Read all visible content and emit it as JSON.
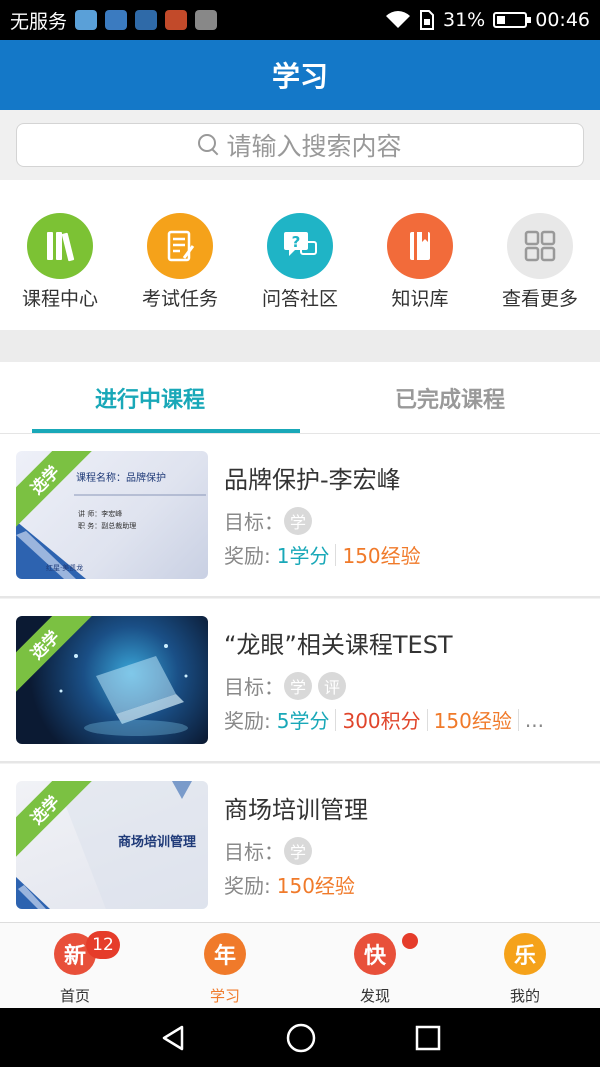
{
  "status_bar": {
    "carrier": "无服务",
    "battery_percent": "31%",
    "time": "00:46",
    "icons": [
      "app-icon",
      "chart-icon",
      "usb-icon",
      "blocked-icon",
      "image-icon",
      "wifi-icon",
      "sim-icon",
      "battery-icon"
    ]
  },
  "header": {
    "title": "学习"
  },
  "search": {
    "placeholder": "请输入搜索内容",
    "icon": "search-icon"
  },
  "quick_nav": [
    {
      "label": "课程中心",
      "icon": "books-icon",
      "color": "#7cc234"
    },
    {
      "label": "考试任务",
      "icon": "checklist-icon",
      "color": "#f5a21a"
    },
    {
      "label": "问答社区",
      "icon": "qa-chat-icon",
      "color": "#1fb4c6"
    },
    {
      "label": "知识库",
      "icon": "book-icon",
      "color": "#f26b3a"
    },
    {
      "label": "查看更多",
      "icon": "grid-icon",
      "color": "#e8e8e8"
    }
  ],
  "tabs": [
    {
      "label": "进行中课程",
      "active": true
    },
    {
      "label": "已完成课程",
      "active": false
    }
  ],
  "courses": [
    {
      "tag": "选学",
      "title": "品牌保护-李宏峰",
      "goal_label": "目标：",
      "goals": [
        "学"
      ],
      "reward_label": "奖励:",
      "rewards": [
        {
          "text": "1学分",
          "color": "#19a8b8"
        },
        {
          "text": "150经验",
          "color": "#f07a2a"
        }
      ],
      "more": "",
      "thumb": {
        "title": "课程名称：品牌保护",
        "line1": "讲  师：李宏峰",
        "line2": "职  务：副总裁助理",
        "logo": "红星·美凯龙"
      }
    },
    {
      "tag": "选学",
      "title": "“龙眼”相关课程TEST",
      "goal_label": "目标：",
      "goals": [
        "学",
        "评"
      ],
      "reward_label": "奖励:",
      "rewards": [
        {
          "text": "5学分",
          "color": "#19a8b8"
        },
        {
          "text": "300积分",
          "color": "#e0452b"
        },
        {
          "text": "150经验",
          "color": "#f07a2a"
        }
      ],
      "more": "...",
      "thumb": {}
    },
    {
      "tag": "选学",
      "title": "商场培训管理",
      "goal_label": "目标：",
      "goals": [
        "学"
      ],
      "reward_label": "奖励:",
      "rewards": [
        {
          "text": "150经验",
          "color": "#f07a2a"
        }
      ],
      "more": "",
      "thumb": {
        "title": "商场培训管理"
      }
    }
  ],
  "bottom_nav": [
    {
      "label": "首页",
      "icon_text": "新",
      "badge": "12",
      "active": false,
      "color": "#e8503a"
    },
    {
      "label": "学习",
      "icon_text": "年",
      "active": true,
      "color": "#f07a2a"
    },
    {
      "label": "发现",
      "icon_text": "快",
      "dot": true,
      "active": false,
      "color": "#e8503a"
    },
    {
      "label": "我的",
      "icon_text": "乐",
      "active": false,
      "color": "#f5a21a"
    }
  ],
  "system_nav": [
    "back-icon",
    "home-icon",
    "recents-icon"
  ]
}
